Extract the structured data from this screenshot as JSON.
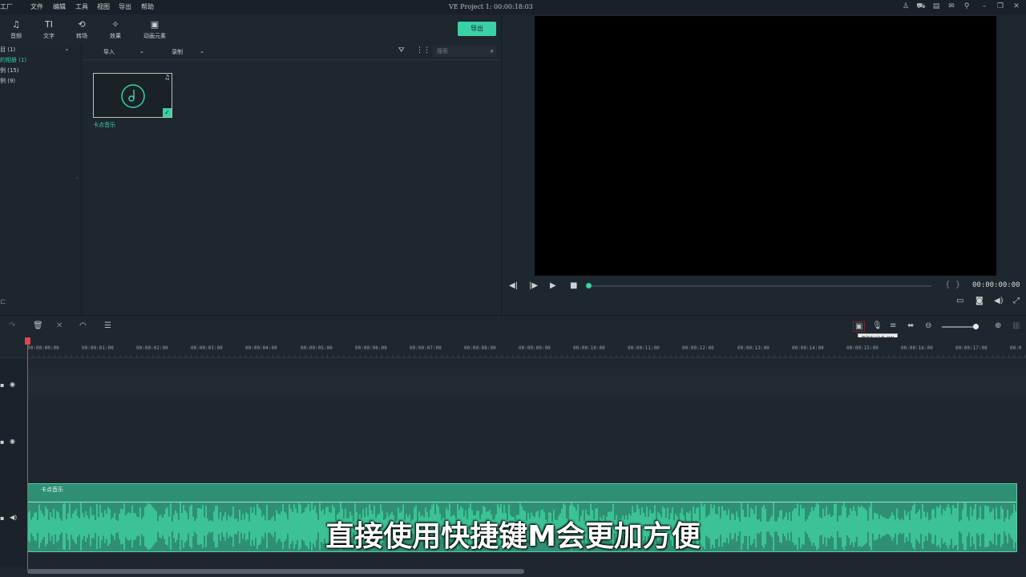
{
  "app": {
    "title_fragment": "工厂",
    "window_title": "VE Project 1: 00:00:18:03"
  },
  "menu": [
    "文件",
    "编辑",
    "工具",
    "视图",
    "导出",
    "帮助"
  ],
  "window_icons": [
    "user-icon",
    "cart-icon",
    "save-icon",
    "mail-icon",
    "mic-icon",
    "minimize-icon",
    "restore-icon",
    "close-icon"
  ],
  "media_toolbar": {
    "tools": [
      {
        "label": "音频",
        "icon": "♫"
      },
      {
        "label": "文字",
        "icon": "TI"
      },
      {
        "label": "转场",
        "icon": "⟲"
      },
      {
        "label": "效果",
        "icon": "✧"
      },
      {
        "label": "动画元素",
        "icon": "▣"
      }
    ],
    "export_label": "导出"
  },
  "left_panel": {
    "items": [
      "目 (1)",
      "的相册 (1)",
      "例 (15)",
      "例 (9)"
    ]
  },
  "library": {
    "import_label": "导入",
    "record_label": "录制",
    "search_placeholder": "搜索",
    "media_name": "卡点音乐"
  },
  "preview": {
    "timecode": "00:00:00:00"
  },
  "timeline": {
    "tooltip": "添加标记点 (M)",
    "ruler": [
      "00:00:00:00",
      "00:00:01:00",
      "00:00:02:00",
      "00:00:03:00",
      "00:00:04:00",
      "00:00:05:00",
      "00:00:06:00",
      "00:00:07:00",
      "00:00:08:00",
      "00:00:09:00",
      "00:00:10:00",
      "00:00:11:00",
      "00:00:12:00",
      "00:00:13:00",
      "00:00:14:00",
      "00:00:15:00",
      "00:00:16:00",
      "00:00:17:00",
      "00:0"
    ],
    "audio_clip_label": "卡点音乐"
  },
  "subtitle": "直接使用快捷键M会更加方便",
  "colors": {
    "accent": "#3ad1a6",
    "playhead": "#e0474c",
    "clip": "#2f8f74"
  }
}
